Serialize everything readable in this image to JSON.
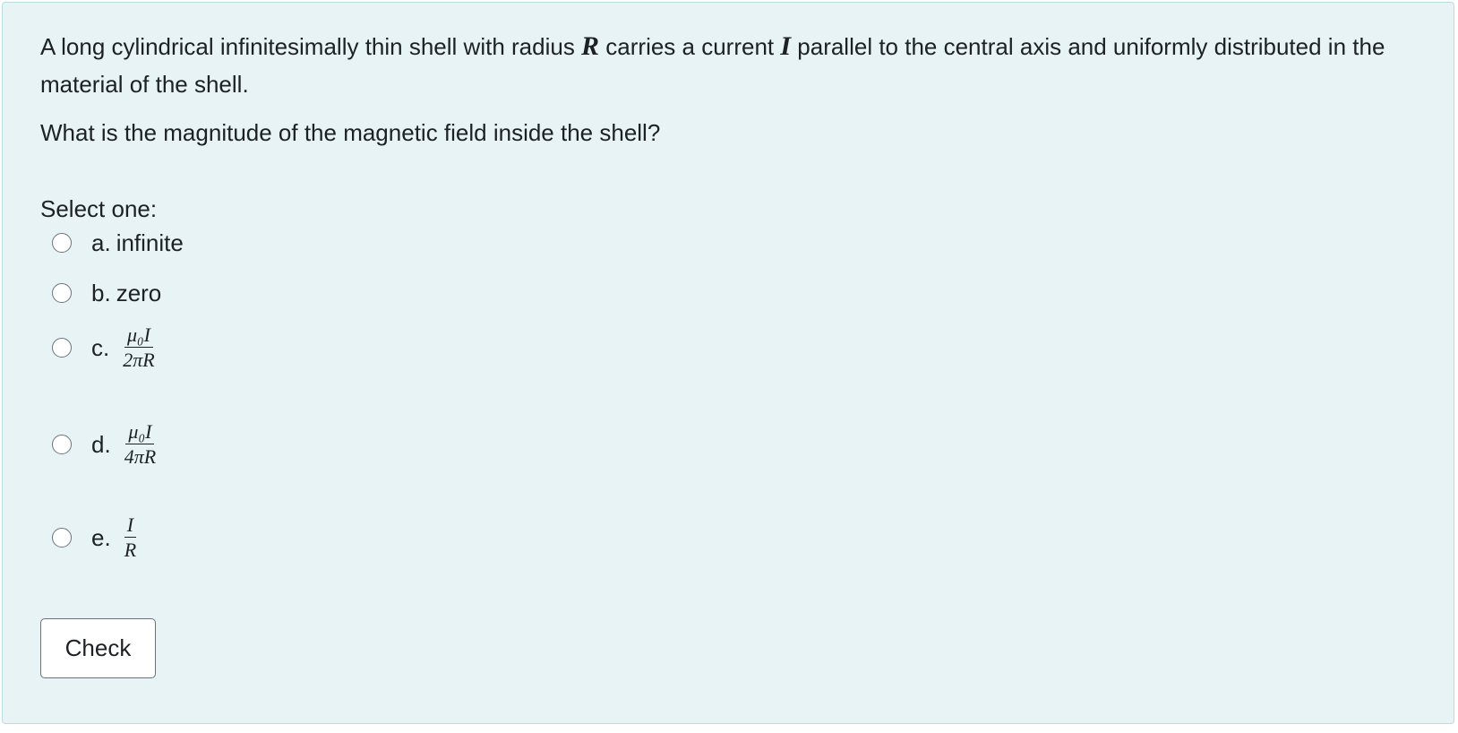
{
  "question": {
    "part1": "A long cylindrical infinitesimally thin shell with radius ",
    "var_R": "R",
    "part2": " carries a current ",
    "var_I": "I",
    "part3": " parallel to the central axis and uniformly distributed in the material of the shell.",
    "question_text": "What is the magnitude of the magnetic field inside the shell?"
  },
  "prompt": "Select one:",
  "options": [
    {
      "letter": "a.",
      "text": "infinite"
    },
    {
      "letter": "b.",
      "text": "zero"
    },
    {
      "letter": "c.",
      "numerator": "μ₀I",
      "denominator": "2πR"
    },
    {
      "letter": "d.",
      "numerator": "μ₀I",
      "denominator": "4πR"
    },
    {
      "letter": "e.",
      "numerator": "I",
      "denominator": "R"
    }
  ],
  "check_label": "Check",
  "colors": {
    "panel_background": "#e7f3f5",
    "panel_border": "#b8dce2",
    "text": "#1d2125"
  }
}
